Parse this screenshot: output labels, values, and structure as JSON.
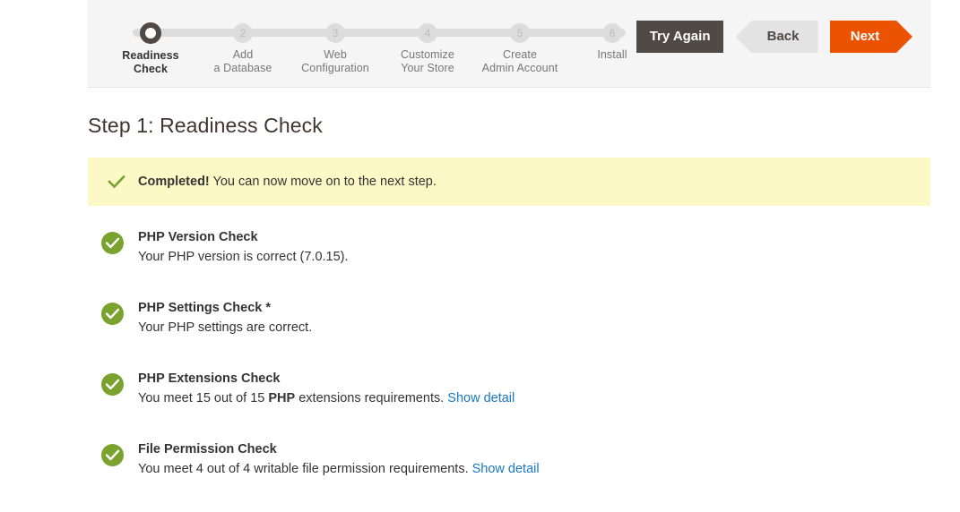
{
  "colors": {
    "accent_orange": "#eb5202",
    "dark_brown": "#514943",
    "green": "#79a22e",
    "link_blue": "#1979c3",
    "notice_yellow": "#fdf9c7",
    "panel_gray": "#f5f5f5",
    "inactive_gray": "#dcdcdc"
  },
  "wizard": {
    "steps": [
      {
        "number": "1",
        "label_line1": "Readiness",
        "label_line2": "Check",
        "state": "active"
      },
      {
        "number": "2",
        "label_line1": "Add",
        "label_line2": "a Database",
        "state": "inactive"
      },
      {
        "number": "3",
        "label_line1": "Web",
        "label_line2": "Configuration",
        "state": "inactive"
      },
      {
        "number": "4",
        "label_line1": "Customize",
        "label_line2": "Your Store",
        "state": "inactive"
      },
      {
        "number": "5",
        "label_line1": "Create",
        "label_line2": "Admin Account",
        "state": "inactive"
      },
      {
        "number": "6",
        "label_line1": "Install",
        "label_line2": "",
        "state": "inactive"
      }
    ],
    "buttons": {
      "try_again": "Try Again",
      "back": "Back",
      "next": "Next"
    }
  },
  "main": {
    "title": "Step 1: Readiness Check",
    "notice": {
      "status": "Completed!",
      "message": "You can now move on to the next step.",
      "icon": "check-icon"
    },
    "checks": [
      {
        "title": "PHP Version Check",
        "desc_before": "Your PHP version is correct (7.0.15).",
        "desc_bold": "",
        "desc_after": "",
        "link": "",
        "status": "ok"
      },
      {
        "title": "PHP Settings Check *",
        "desc_before": "Your PHP settings are correct.",
        "desc_bold": "",
        "desc_after": "",
        "link": "",
        "status": "ok"
      },
      {
        "title": "PHP Extensions Check",
        "desc_before": "You meet 15 out of 15 ",
        "desc_bold": "PHP",
        "desc_after": " extensions requirements. ",
        "link": "Show detail",
        "status": "ok"
      },
      {
        "title": "File Permission Check",
        "desc_before": "You meet 4 out of 4 writable file permission requirements. ",
        "desc_bold": "",
        "desc_after": "",
        "link": "Show detail",
        "status": "ok"
      }
    ]
  }
}
